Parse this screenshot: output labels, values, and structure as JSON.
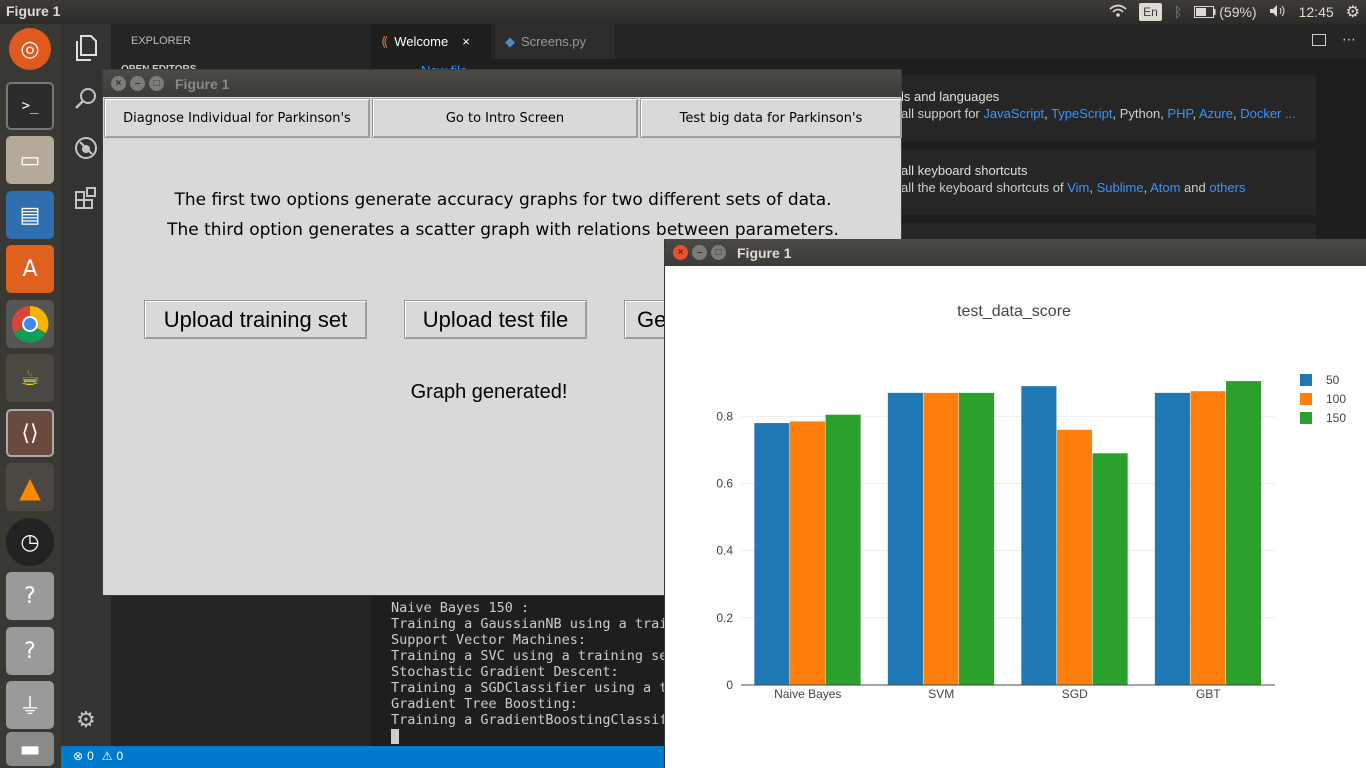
{
  "topbar": {
    "app_title": "Figure 1",
    "lang": "En",
    "battery": "(59%)",
    "time": "12:45"
  },
  "launcher": {
    "items": [
      "ubuntu-icon",
      "terminal-icon",
      "files-icon",
      "document-icon",
      "software-center-icon",
      "chrome-icon",
      "teapot-icon",
      "vscode-icon",
      "vlc-icon",
      "clock-icon",
      "unknown-icon",
      "unknown-icon",
      "usb-icon",
      "trash-icon"
    ]
  },
  "vscode": {
    "explorer": "EXPLORER",
    "open_editors": "OPEN EDITORS",
    "tabs": [
      {
        "label": "Welcome",
        "close": "×"
      },
      {
        "label": "Screens.py"
      }
    ],
    "welcome": {
      "cards": [
        {
          "title": "ls and languages",
          "desc_prefix": "all support for ",
          "links": [
            "JavaScript",
            "TypeScript"
          ],
          "mid": ", Python, ",
          "links2": [
            "PHP",
            "Azure",
            "Docker ..."
          ]
        },
        {
          "title": "all keyboard shortcuts",
          "desc_prefix": "all the keyboard shortcuts of ",
          "k1": "Vim",
          "k2": "Sublime",
          "k3": "Atom",
          "and": " and ",
          "k4": "others"
        }
      ],
      "peek": "New file"
    },
    "terminal": [
      "Naive Bayes 150 :",
      "Training a GaussianNB using a trai",
      "Support Vector Machines:",
      "Training a SVC using a training se",
      "Stochastic Gradient Descent:",
      "Training a SGDClassifier using a t",
      "Gradient Tree Boosting:",
      "Training a GradientBoostingClassif"
    ],
    "status": {
      "errors": "0",
      "warnings": "0"
    }
  },
  "figure1": {
    "title": "Figure 1",
    "top_buttons": [
      "Diagnose Individual for Parkinson's",
      "Go to Intro Screen",
      "Test big data for Parkinson's"
    ],
    "info_line1": "The first two options generate accuracy graphs for two different sets of data.",
    "info_line2": "The third option generates a scatter graph with relations between parameters.",
    "actions": [
      "Upload training set",
      "Upload test file",
      "Ge"
    ],
    "status": "Graph generated!"
  },
  "figure2": {
    "title": "Figure 1"
  },
  "chart_data": {
    "type": "bar",
    "title": "test_data_score",
    "categories": [
      "Naive Bayes",
      "SVM",
      "SGD",
      "GBT"
    ],
    "series": [
      {
        "name": "50",
        "values": [
          0.78,
          0.87,
          0.89,
          0.87
        ],
        "color": "#1f77b4"
      },
      {
        "name": "100",
        "values": [
          0.785,
          0.87,
          0.76,
          0.875
        ],
        "color": "#ff7f0e"
      },
      {
        "name": "150",
        "values": [
          0.805,
          0.87,
          0.69,
          0.905
        ],
        "color": "#2ca02c"
      }
    ],
    "yticks": [
      "0",
      "0.2",
      "0.4",
      "0.6",
      "0.8"
    ],
    "ylim": [
      0,
      0.95
    ],
    "grid": true,
    "legend": "top-right"
  }
}
